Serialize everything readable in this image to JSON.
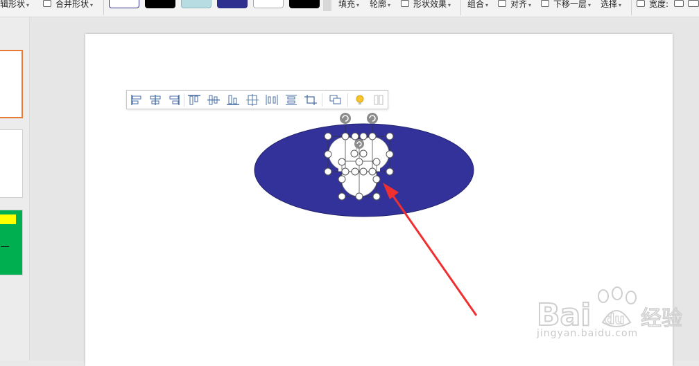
{
  "ribbon": {
    "edit_shape": "辑形状",
    "merge_shape": "合并形状",
    "fill": "填充",
    "outline": "轮廓",
    "shape_effects": "形状效果",
    "group": "组合",
    "align": "对齐",
    "send_backward": "下移一层",
    "select": "选择",
    "width": "宽度:",
    "swatches": [
      {
        "fill": "#ffffff",
        "border": "#2f2f8f"
      },
      {
        "fill": "#000000",
        "border": "#000000"
      },
      {
        "fill": "#b7dde3",
        "border": "#8fb9c0"
      },
      {
        "fill": "#2f2f8f",
        "border": "#2f2f8f"
      },
      {
        "fill": "#ffffff",
        "border": "#aaaaaa"
      },
      {
        "fill": "#000000",
        "border": "#000000"
      }
    ]
  },
  "align_toolbar": {
    "items": [
      "align-left-icon",
      "align-center-icon",
      "align-right-icon",
      "align-top-icon",
      "align-middle-icon",
      "align-bottom-icon",
      "align-canvas-center-icon",
      "distribute-horizontal-icon",
      "distribute-vertical-icon",
      "crop-icon",
      "group-icon",
      "lightbulb-icon",
      "more-icon"
    ]
  },
  "watermark": {
    "brand": "Bai",
    "brand_cn": "经验",
    "url": "jingyan.baidu.com"
  },
  "colors": {
    "ellipse": "#32329a",
    "arrow": "#f03030",
    "accent_orange": "#e87a35",
    "thumb_green": "#00b050",
    "thumb_yellow": "#ffff00"
  }
}
